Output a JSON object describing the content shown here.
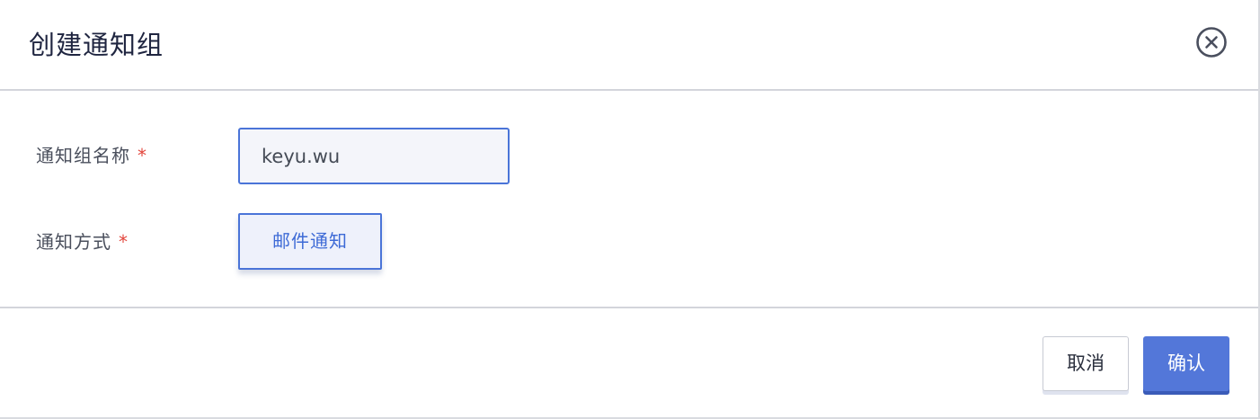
{
  "dialog": {
    "title": "创建通知组",
    "close_icon": "close-circle-icon"
  },
  "form": {
    "name_label": "通知组名称",
    "name_required": "*",
    "name_value": "keyu.wu",
    "method_label": "通知方式",
    "method_required": "*",
    "method_option": "邮件通知"
  },
  "footer": {
    "cancel_label": "取消",
    "confirm_label": "确认"
  },
  "colors": {
    "accent": "#4a74d8",
    "primary_button": "#5377d9",
    "required_mark": "#e2453c",
    "title_text": "#1f2540"
  }
}
